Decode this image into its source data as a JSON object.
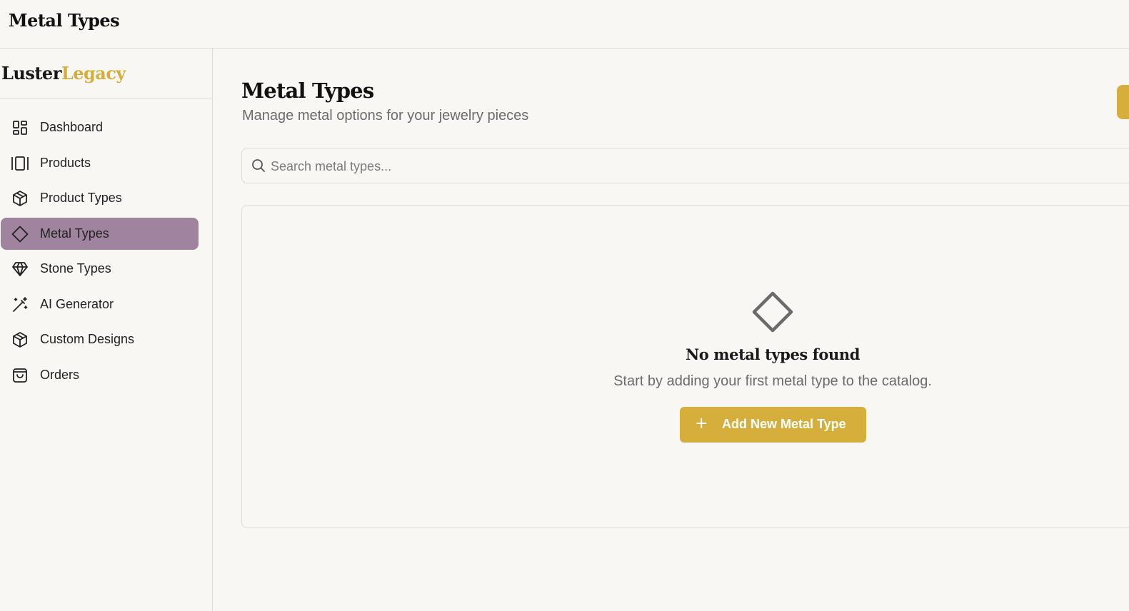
{
  "header": {
    "title": "Metal Types"
  },
  "brand": {
    "part1": "Luster",
    "part2": "Legacy"
  },
  "sidebar": {
    "items": [
      {
        "label": "Dashboard",
        "icon": "dashboard-icon"
      },
      {
        "label": "Products",
        "icon": "products-icon"
      },
      {
        "label": "Product Types",
        "icon": "box-icon"
      },
      {
        "label": "Metal Types",
        "icon": "diamond-icon",
        "active": true
      },
      {
        "label": "Stone Types",
        "icon": "gem-icon"
      },
      {
        "label": "AI Generator",
        "icon": "magic-wand-icon"
      },
      {
        "label": "Custom Designs",
        "icon": "box-icon"
      },
      {
        "label": "Orders",
        "icon": "shopping-bag-icon"
      }
    ]
  },
  "main": {
    "title": "Metal Types",
    "subtitle": "Manage metal options for your jewelry pieces",
    "search": {
      "placeholder": "Search metal types..."
    },
    "empty": {
      "icon": "diamond-icon",
      "title": "No metal types found",
      "text": "Start by adding your first metal type to the catalog.",
      "button_label": "Add New Metal Type"
    }
  },
  "colors": {
    "accent": "#d6ae3c",
    "active_nav": "#a0839e",
    "background": "#f9f7f4"
  }
}
